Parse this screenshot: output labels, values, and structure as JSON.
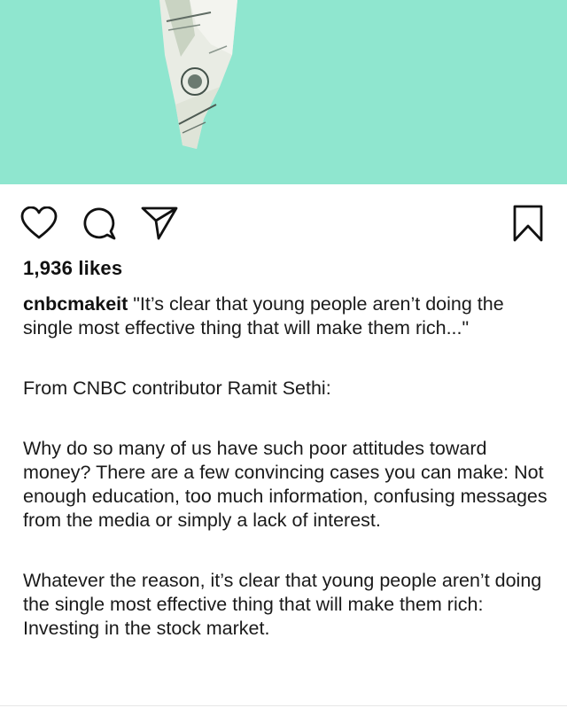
{
  "post": {
    "image": {
      "description_icon": "folded-dollar-bill-image",
      "background_color": "#8fe6cf"
    },
    "actions": {
      "like_icon": "heart-icon",
      "comment_icon": "comment-icon",
      "share_icon": "send-icon",
      "save_icon": "bookmark-icon"
    },
    "likes": "1,936 likes",
    "caption": {
      "username": "cnbcmakeit",
      "intro": " \"It’s clear that young people aren’t doing the single most effective thing that will make them rich...\"",
      "paragraphs": [
        "From CNBC contributor Ramit Sethi:",
        "Why do so many of us have such poor attitudes toward money? There are a few convincing cases you can make: Not enough education, too much information, confusing messages from the media or simply a lack of interest.",
        "Whatever the reason, it’s clear that young people aren’t doing the single most effective thing that will make them rich: Investing in the stock market."
      ]
    }
  }
}
